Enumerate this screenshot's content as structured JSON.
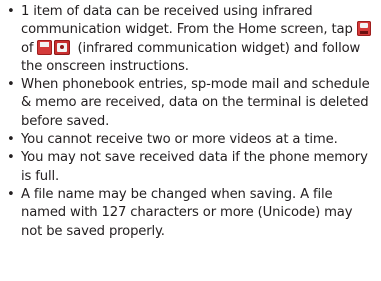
{
  "bullets": [
    {
      "part1": "1 item of data can be received using infrared communication widget. From the Home screen, tap",
      "icon1": "infrared-communication-icon",
      "part2": "of",
      "icon2": "infrared-communication-widget-icon",
      "part3": "(infrared communication widget) and follow the onscreen instructions."
    },
    {
      "text": "When phonebook entries, sp-mode mail and schedule & memo are received, data on the terminal is deleted before saved."
    },
    {
      "text": "You cannot receive two or more videos at a time."
    },
    {
      "text": "You may not save received data if the phone memory is full."
    },
    {
      "text": "A file name may be changed when saving. A file named with 127 characters or more (Unicode) may not be saved properly."
    }
  ],
  "bullet_symbol": "•",
  "colors": {
    "text": "#231f20",
    "icon_red": "#d43a3a"
  }
}
